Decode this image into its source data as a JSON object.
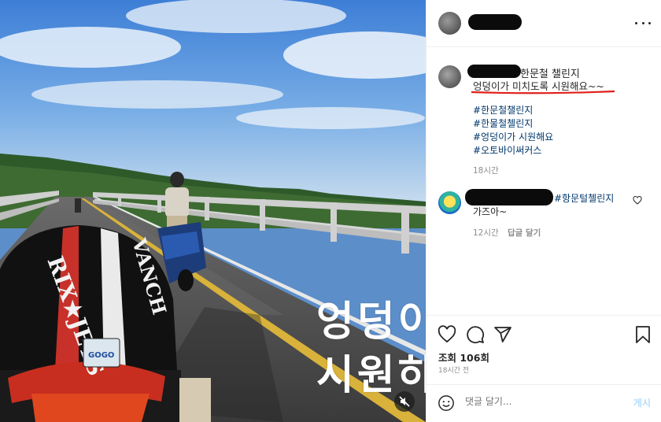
{
  "media": {
    "overlay_line1": "엉덩이",
    "overlay_line2": "시원하",
    "helmet_text_left": "RIX★JETS",
    "helmet_text_right": "VANCH",
    "helmet_sticker": "GOGO",
    "mute_icon": "speaker-muted-icon"
  },
  "header": {
    "more_icon": "more-horizontal-icon"
  },
  "caption": {
    "title": "한문철 챌린지",
    "body": "엉덩이가 미치도록 시원해요~~",
    "hashtags": [
      "#한문철챌린지",
      "#한물철첼린지",
      "#엉덩이가 시원해요",
      "#오토바이써커스"
    ],
    "time": "18시간"
  },
  "comment": {
    "tag": "#항문털첼린지",
    "text": "가즈아~",
    "time": "12시간",
    "reply_label": "답글 달기"
  },
  "actions": {
    "icons": [
      "heart-icon",
      "comment-icon",
      "share-icon",
      "bookmark-icon"
    ],
    "views": "조회 106회",
    "posted": "18시간 전"
  },
  "comment_bar": {
    "placeholder": "댓글 달기...",
    "post_label": "게시"
  },
  "colors": {
    "link": "#00376b",
    "underline": "#e0201b",
    "post_button": "#b2dffc"
  }
}
